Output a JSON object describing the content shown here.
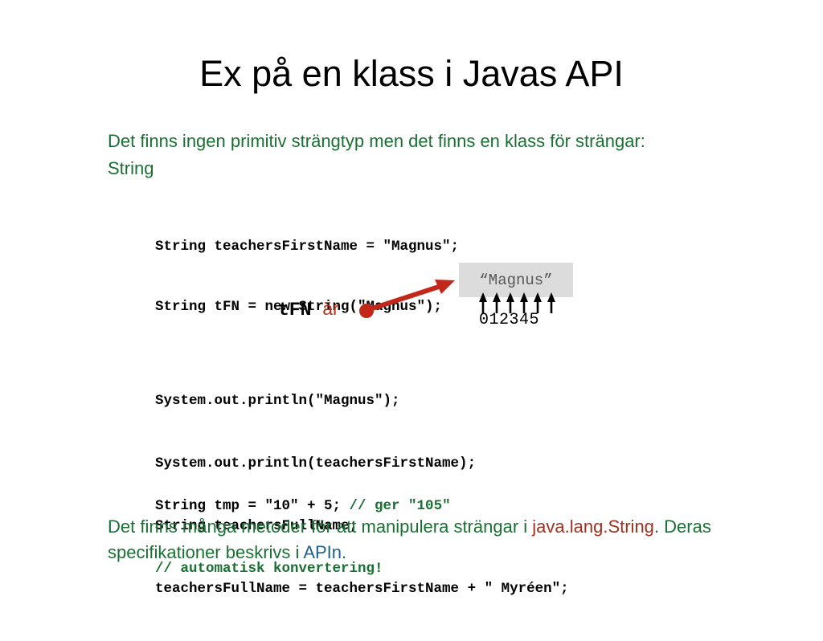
{
  "slide": {
    "title": "Ex på en klass i Javas API",
    "intro_paragraph": "Det finns ingen primitiv strängtyp men det finns en klass för strängar: String",
    "code_block_1": [
      "String teachersFirstName = \"Magnus\";",
      "String tFN = new String(\"Magnus\");"
    ],
    "code_block_2": [
      "System.out.println(\"Magnus\");",
      "System.out.println(teachersFirstName);",
      "String teachersFullName;",
      "teachersFullName = teachersFirstName + \" Myréen\";"
    ],
    "code_block_3": {
      "line1_code": "String tmp = \"10\" + 5; ",
      "line1_comment": "// ger \"105\"",
      "line2_comment": "// automatisk konvertering!"
    },
    "diagram": {
      "pointer_var": "tFN",
      "pointer_verb": "är",
      "string_value": "“Magnus”",
      "index_digits": "012345",
      "arrow_color": "#c1281a",
      "box_fill": "#dcdcdc",
      "string_text_color": "#585858"
    },
    "outro": {
      "part1": "Det finns många metoder för att manipulera strängar i ",
      "class_name": "java.lang.String",
      "part2": ". Deras specifikationer beskrivs i ",
      "api_link": "APIn",
      "part3": "."
    },
    "colors": {
      "title": "#000000",
      "body_green": "#1a7032",
      "code_black": "#000000",
      "comment_green": "#1a7032",
      "accent_red": "#b93217",
      "link_blue": "#1f6090"
    }
  }
}
